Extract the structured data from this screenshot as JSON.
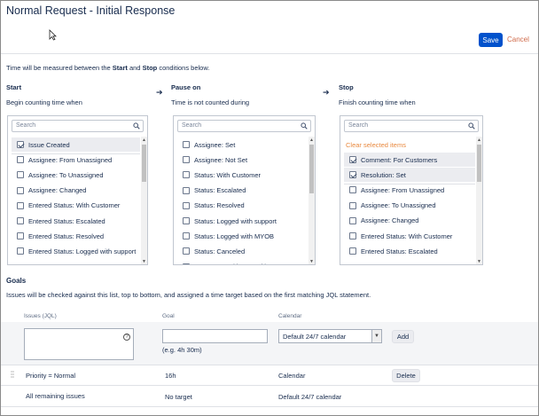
{
  "header": {
    "title": "Normal Request - Initial Response",
    "save_label": "Save",
    "cancel_label": "Cancel"
  },
  "intro": {
    "prefix": "Time will be measured between the ",
    "start_word": "Start",
    "middle": " and ",
    "stop_word": "Stop",
    "suffix": " conditions below."
  },
  "columns": {
    "start": {
      "heading": "Start",
      "subheading": "Begin counting time when",
      "search_placeholder": "Search",
      "items": [
        {
          "label": "Issue Created",
          "checked": true
        },
        {
          "label": "Assignee: From Unassigned",
          "checked": false
        },
        {
          "label": "Assignee: To Unassigned",
          "checked": false
        },
        {
          "label": "Assignee: Changed",
          "checked": false
        },
        {
          "label": "Entered Status: With Customer",
          "checked": false
        },
        {
          "label": "Entered Status: Escalated",
          "checked": false
        },
        {
          "label": "Entered Status: Resolved",
          "checked": false
        },
        {
          "label": "Entered Status: Logged with support",
          "checked": false
        }
      ]
    },
    "pause": {
      "heading": "Pause on",
      "subheading": "Time is not counted during",
      "search_placeholder": "Search",
      "items": [
        {
          "label": "Assignee: Set",
          "checked": false
        },
        {
          "label": "Assignee: Not Set",
          "checked": false
        },
        {
          "label": "Status: With Customer",
          "checked": false
        },
        {
          "label": "Status: Escalated",
          "checked": false
        },
        {
          "label": "Status: Resolved",
          "checked": false
        },
        {
          "label": "Status: Logged with support",
          "checked": false
        },
        {
          "label": "Status: Logged with MYOB",
          "checked": false
        },
        {
          "label": "Status: Canceled",
          "checked": false
        },
        {
          "label": "Status: Transition to With Customer",
          "checked": false
        }
      ]
    },
    "stop": {
      "heading": "Stop",
      "subheading": "Finish counting time when",
      "search_placeholder": "Search",
      "clear_label": "Clear selected items",
      "items": [
        {
          "label": "Comment: For Customers",
          "checked": true
        },
        {
          "label": "Resolution: Set",
          "checked": true
        },
        {
          "label": "Assignee: From Unassigned",
          "checked": false
        },
        {
          "label": "Assignee: To Unassigned",
          "checked": false
        },
        {
          "label": "Assignee: Changed",
          "checked": false
        },
        {
          "label": "Entered Status: With Customer",
          "checked": false
        },
        {
          "label": "Entered Status: Escalated",
          "checked": false
        }
      ]
    }
  },
  "goals": {
    "title": "Goals",
    "description": "Issues will be checked against this list, top to bottom, and assigned a time target based on the first matching JQL statement.",
    "headers": {
      "issues": "Issues (JQL)",
      "goal": "Goal",
      "calendar": "Calendar"
    },
    "new_goal": {
      "jql_value": "",
      "goal_value": "",
      "goal_hint": "(e.g. 4h 30m)",
      "calendar_selected": "Default 24/7 calendar",
      "add_label": "Add"
    },
    "rows": [
      {
        "issues": "Priority = Normal",
        "goal": "16h",
        "calendar": "Calendar",
        "action": "Delete"
      },
      {
        "issues": "All remaining issues",
        "goal": "No target",
        "calendar": "Default 24/7 calendar",
        "action": ""
      }
    ]
  }
}
